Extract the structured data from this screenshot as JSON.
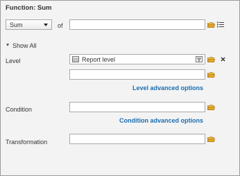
{
  "header": {
    "title": "Function: Sum"
  },
  "function_row": {
    "selected": "Sum",
    "of_label": "of",
    "value": ""
  },
  "show_all": {
    "label": "Show All"
  },
  "level": {
    "label": "Level",
    "value": "Report level",
    "second_value": "",
    "advanced_link": "Level advanced options"
  },
  "condition": {
    "label": "Condition",
    "value": "",
    "advanced_link": "Condition advanced options"
  },
  "transformation": {
    "label": "Transformation",
    "value": ""
  },
  "colors": {
    "link": "#1a6db0",
    "folder": "#e1a92a",
    "border": "#a9a9a9"
  }
}
